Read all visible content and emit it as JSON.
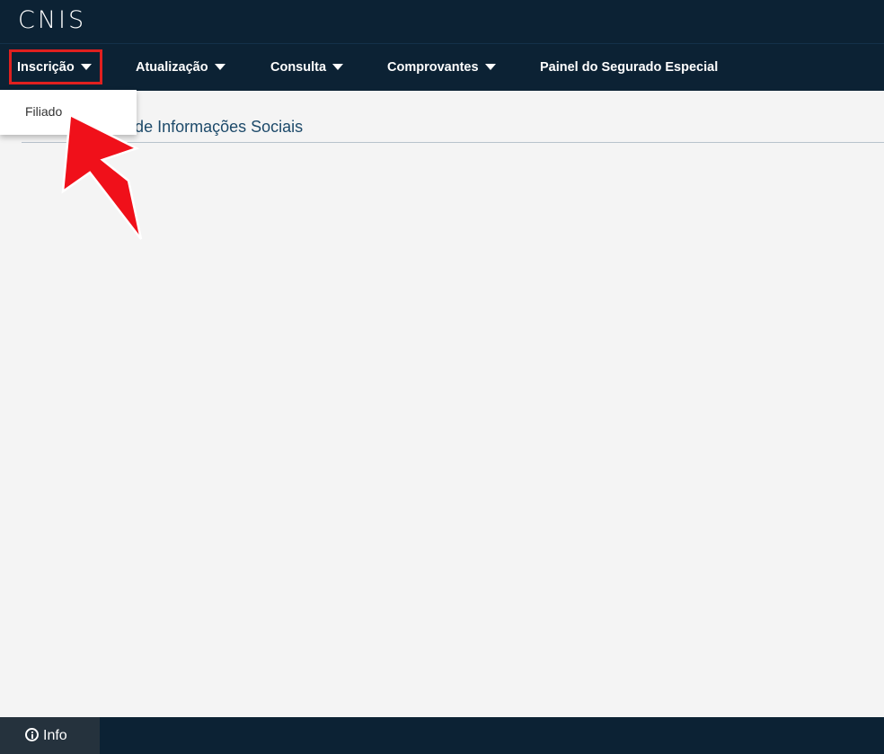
{
  "header": {
    "logo": "CNIS"
  },
  "nav": {
    "items": [
      {
        "label": "Inscrição",
        "has_caret": true
      },
      {
        "label": "Atualização",
        "has_caret": true
      },
      {
        "label": "Consulta",
        "has_caret": true
      },
      {
        "label": "Comprovantes",
        "has_caret": true
      },
      {
        "label": "Painel do Segurado Especial",
        "has_caret": false
      }
    ],
    "active_dropdown": {
      "items": [
        {
          "label": "Filiado"
        }
      ]
    }
  },
  "main": {
    "heading": "o Nacional de Informações Sociais"
  },
  "footer": {
    "info_label": "Info"
  },
  "colors": {
    "navbar_bg": "#0c2234",
    "highlight_box": "#e0201f",
    "arrow": "#f0101a",
    "heading_text": "#1d4a6a",
    "page_bg": "#f4f4f4"
  },
  "icons": {
    "caret": "caret-down-icon",
    "info": "info-circle-icon",
    "annotation": "red-arrow-icon"
  }
}
